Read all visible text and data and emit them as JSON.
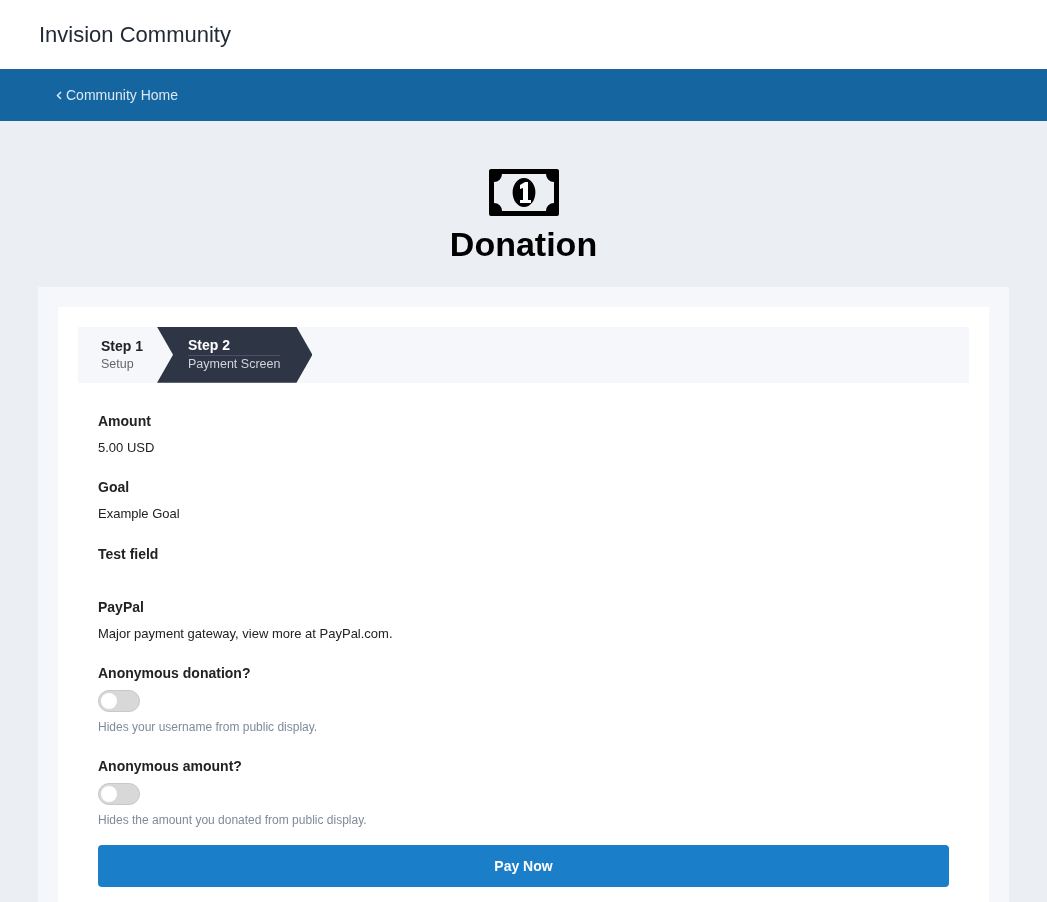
{
  "site_title": "Invision Community",
  "nav": {
    "back_link": "Community Home"
  },
  "page_title": "Donation",
  "steps": [
    {
      "title": "Step 1",
      "subtitle": "Setup",
      "selected": false
    },
    {
      "title": "Step 2",
      "subtitle": "Payment Screen",
      "selected": true
    }
  ],
  "fields": [
    {
      "kind": "value",
      "label": "Amount",
      "value": "5.00 USD"
    },
    {
      "kind": "value",
      "label": "Goal",
      "value": "Example Goal"
    },
    {
      "kind": "label",
      "label": "Test field"
    },
    {
      "kind": "value",
      "label": "PayPal",
      "value": "Major payment gateway, view more at PayPal.com."
    },
    {
      "kind": "toggle",
      "label": "Anonymous donation?",
      "on": false,
      "description": "Hides your username from public display."
    },
    {
      "kind": "toggle",
      "label": "Anonymous amount?",
      "on": false,
      "description": "Hides the amount you donated from public display."
    }
  ],
  "submit_button": "Pay Now"
}
